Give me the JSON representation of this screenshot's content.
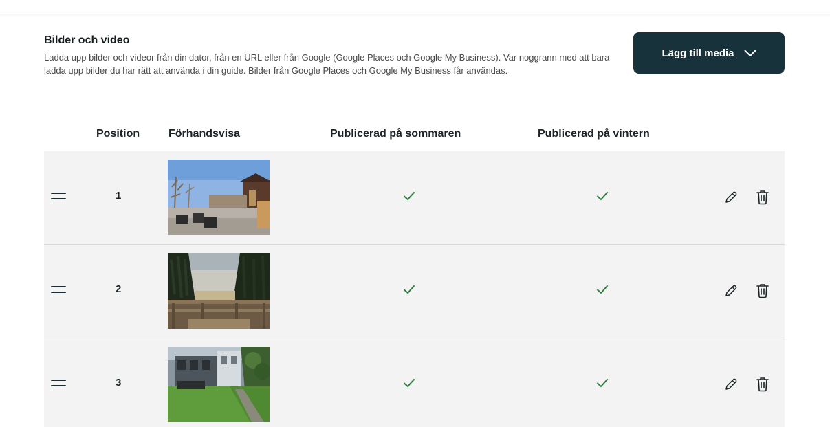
{
  "section": {
    "title": "Bilder och video",
    "description": "Ladda upp bilder och videor från din dator, från en URL eller från Google (Google Places och Google My Business). Var noggrann med att bara ladda upp bilder du har rätt att använda i din guide. Bilder från Google Places och Google My Business får användas.",
    "add_media_label": "Lägg till media"
  },
  "table": {
    "columns": {
      "position": "Position",
      "preview": "Förhandsvisa",
      "summer": "Publicerad på sommaren",
      "winter": "Publicerad på vintern"
    },
    "rows": [
      {
        "position": "1",
        "published_summer": true,
        "published_winter": true
      },
      {
        "position": "2",
        "published_summer": true,
        "published_winter": true
      },
      {
        "position": "3",
        "published_summer": true,
        "published_winter": true
      }
    ]
  },
  "colors": {
    "accent": "#17323a",
    "check": "#2e7d3e",
    "row_bg": "#f3f3f3"
  },
  "icons": {
    "drag": "drag-handle-icon",
    "check": "checkmark-icon",
    "edit": "pencil-icon",
    "delete": "trash-icon",
    "dropdown": "chevron-down-icon"
  }
}
